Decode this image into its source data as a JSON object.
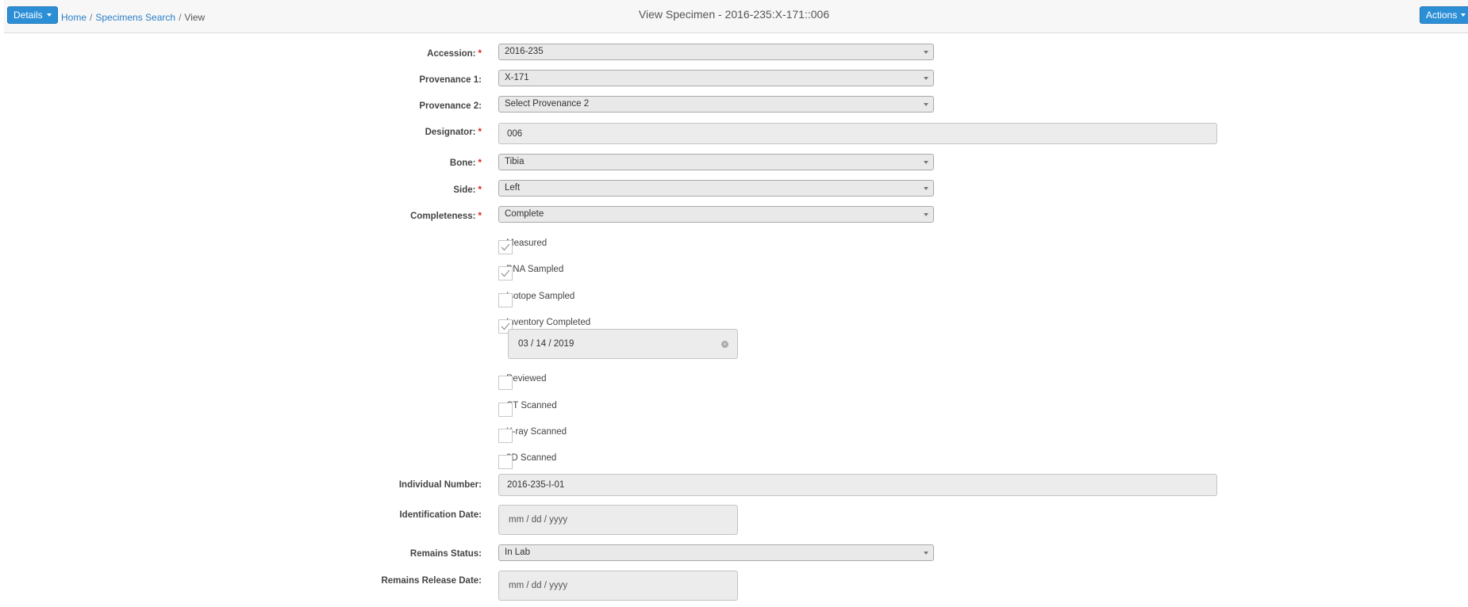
{
  "header": {
    "details_label": "Details",
    "actions_label": "Actions",
    "breadcrumb": {
      "home": "Home",
      "specimens_search": "Specimens Search",
      "current": "View",
      "separator": "/"
    },
    "title": "View Specimen - 2016-235:X-171::006"
  },
  "form": {
    "accession": {
      "label": "Accession:",
      "value": "2016-235"
    },
    "provenance1": {
      "label": "Provenance 1:",
      "value": "X-171"
    },
    "provenance2": {
      "label": "Provenance 2:",
      "value": "Select Provenance 2"
    },
    "designator": {
      "label": "Designator:",
      "value": "006"
    },
    "bone": {
      "label": "Bone:",
      "value": "Tibia"
    },
    "side": {
      "label": "Side:",
      "value": "Left"
    },
    "completeness": {
      "label": "Completeness:",
      "value": "Complete"
    },
    "checkboxes": {
      "measured": {
        "label": "Measured",
        "checked": true
      },
      "dna_sampled": {
        "label": "DNA Sampled",
        "checked": true
      },
      "isotope_sampled": {
        "label": "Isotope Sampled",
        "checked": false
      },
      "inventory_completed": {
        "label": "Inventory Completed",
        "checked": true,
        "date": "03 / 14 / 2019"
      },
      "reviewed": {
        "label": "Reviewed",
        "checked": false
      },
      "ct_scanned": {
        "label": "CT Scanned",
        "checked": false
      },
      "xray_scanned": {
        "label": "X-ray Scanned",
        "checked": false
      },
      "3d_scanned": {
        "label": "3D Scanned",
        "checked": false
      }
    },
    "individual_number": {
      "label": "Individual Number:",
      "value": "2016-235-I-01"
    },
    "identification_date": {
      "label": "Identification Date:",
      "placeholder": "mm / dd / yyyy"
    },
    "remains_status": {
      "label": "Remains Status:",
      "value": "In Lab"
    },
    "remains_release_date": {
      "label": "Remains Release Date:",
      "placeholder": "mm / dd / yyyy"
    },
    "required_marker": "*"
  },
  "colors": {
    "accent": "#2c8fd6",
    "required": "#e02020",
    "link": "#2a7fc6"
  }
}
